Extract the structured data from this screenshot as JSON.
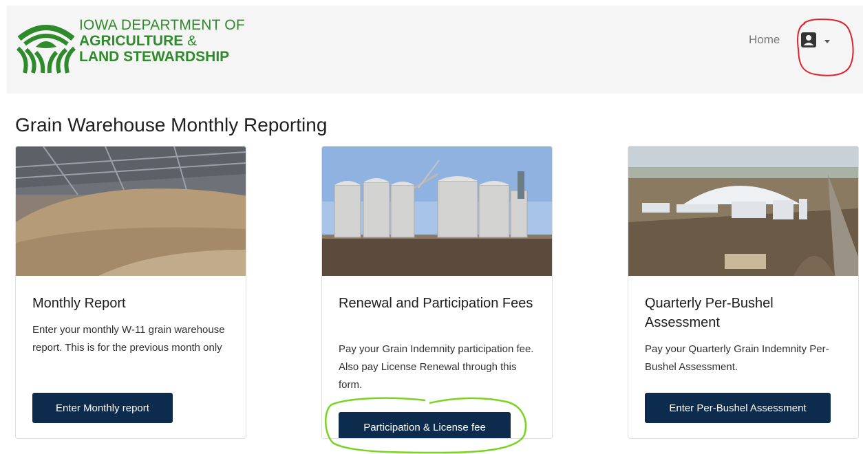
{
  "header": {
    "brand_line1": "IOWA DEPARTMENT OF",
    "brand_line2": "AGRICULTURE",
    "brand_amp": "&",
    "brand_line3": "LAND STEWARDSHIP",
    "nav_home": "Home",
    "logo_icon": "ag-field-logo-icon",
    "profile_icon": "user-profile-icon",
    "dropdown_icon": "caret-down-icon"
  },
  "page": {
    "title": "Grain Warehouse Monthly Reporting"
  },
  "cards": [
    {
      "title": "Monthly Report",
      "text": "Enter your monthly W-11 grain warehouse report. This is for the previous month only",
      "button": "Enter Monthly report"
    },
    {
      "title": "Renewal and Participation Fees",
      "text": "Pay your Grain Indemnity participation fee. Also pay License Renewal through this form.",
      "button": "Participation & License fee"
    },
    {
      "title": "Quarterly Per-Bushel Assessment",
      "text": "Pay your Quarterly Grain Indemnity Per-Bushel Assessment.",
      "button": "Enter Per-Bushel Assessment"
    }
  ],
  "colors": {
    "brand_green": "#2f8a2c",
    "button_navy": "#0d2b4d",
    "annotation_red": "#e0202a",
    "annotation_green": "#7bd321"
  }
}
